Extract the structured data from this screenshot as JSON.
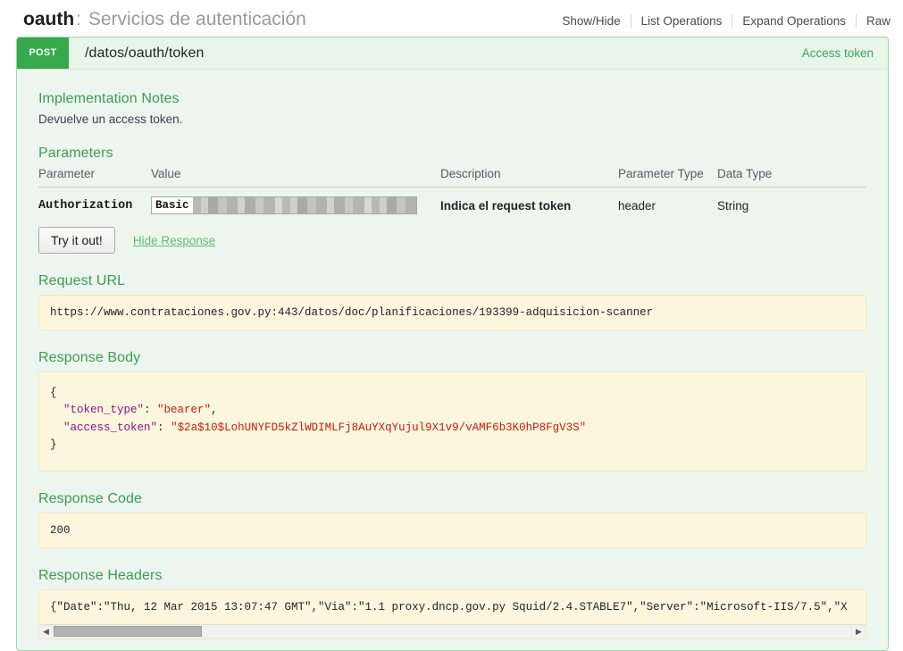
{
  "resource": {
    "name": "oauth",
    "separator": ":",
    "description": "Servicios de autenticación"
  },
  "options": [
    {
      "label": "Show/Hide"
    },
    {
      "label": "List Operations"
    },
    {
      "label": "Expand Operations"
    },
    {
      "label": "Raw"
    }
  ],
  "operation": {
    "method": "POST",
    "path": "/datos/oauth/token",
    "summary": "Access token",
    "implementation_notes_title": "Implementation Notes",
    "implementation_notes_text": "Devuelve un access token.",
    "parameters_title": "Parameters",
    "table": {
      "headers": [
        "Parameter",
        "Value",
        "Description",
        "Parameter Type",
        "Data Type"
      ],
      "rows": [
        {
          "parameter": "Authorization",
          "value_prefix": "Basic",
          "value_redacted": true,
          "description": "Indica el request token",
          "parameter_type": "header",
          "data_type": "String"
        }
      ]
    },
    "try_button": "Try it out!",
    "hide_response": "Hide Response",
    "request_url_title": "Request URL",
    "request_url": "https://www.contrataciones.gov.py:443/datos/doc/planificaciones/193399-adquisicion-scanner",
    "response_body_title": "Response Body",
    "response_body": {
      "open_brace": "{",
      "lines": [
        {
          "key": "\"token_type\"",
          "colon": ": ",
          "value": "\"bearer\"",
          "comma": ","
        },
        {
          "key": "\"access_token\"",
          "colon": ": ",
          "value": "\"$2a$10$LohUNYFD5kZlWDIMLFj8AuYXqYujul9X1v9/vAMF6b3K0hP8FgV3S\"",
          "comma": ""
        }
      ],
      "close_brace": "}"
    },
    "response_code_title": "Response Code",
    "response_code": "200",
    "response_headers_title": "Response Headers",
    "response_headers": "{\"Date\":\"Thu, 12 Mar 2015 13:07:47 GMT\",\"Via\":\"1.1 proxy.dncp.gov.py Squid/2.4.STABLE7\",\"Server\":\"Microsoft-IIS/7.5\",\"X",
    "scrollbar": {
      "left_arrow": "◀",
      "right_arrow": "▶"
    }
  },
  "colors": {
    "method_post": "#36a94c",
    "section_heading": "#3d9c53",
    "panel_border": "#9fd6ac",
    "panel_bg": "#ecf6ee",
    "code_bg": "#fcf6dd"
  }
}
